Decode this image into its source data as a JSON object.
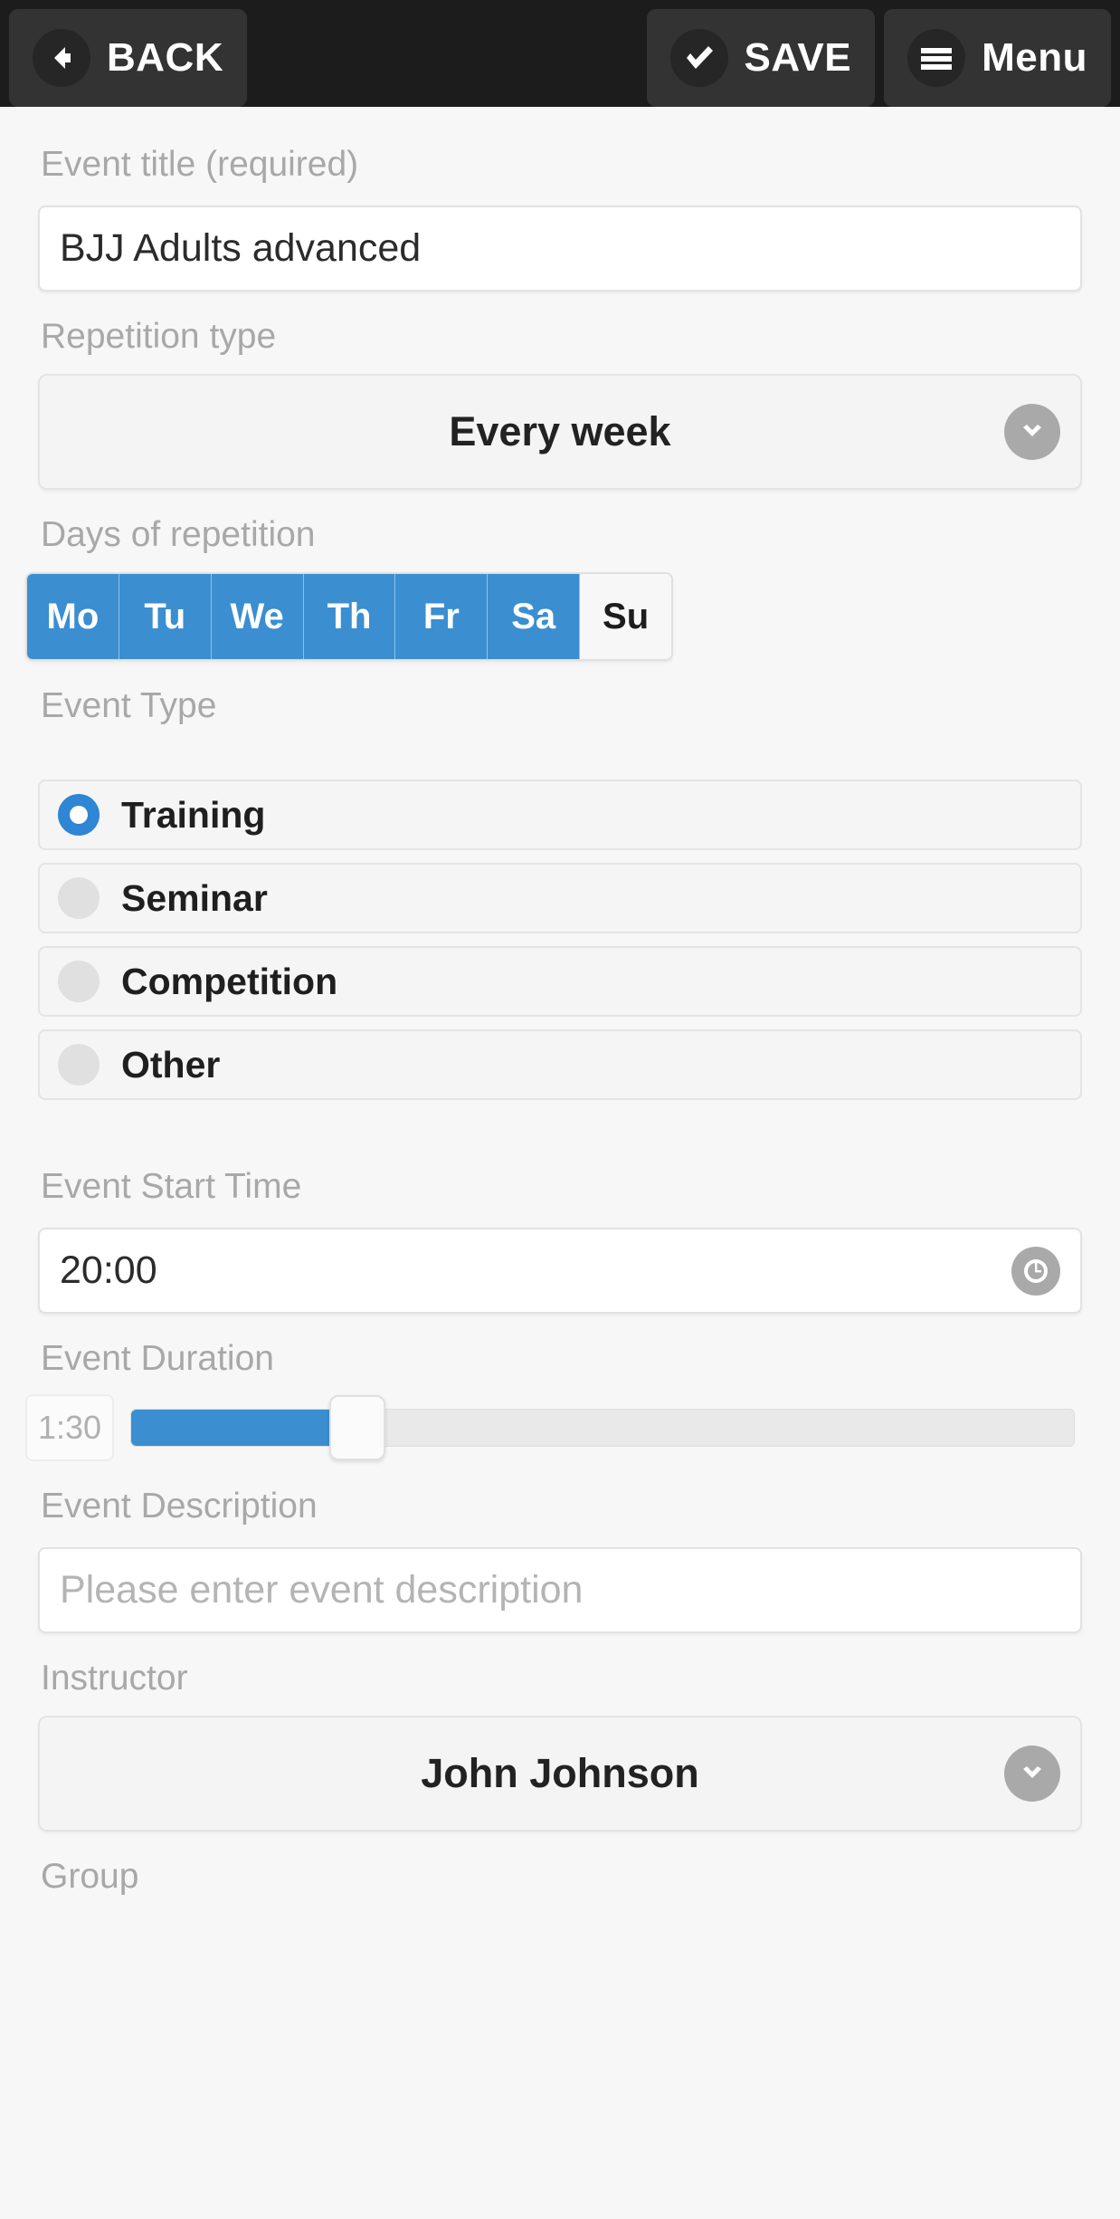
{
  "topbar": {
    "back_label": "BACK",
    "back_icon": "arrow-left-icon",
    "save_label": "SAVE",
    "save_icon": "check-icon",
    "menu_label": "Menu",
    "menu_icon": "hamburger-icon",
    "background_color": "#1c1c1c",
    "button_color": "#333333"
  },
  "form": {
    "title": {
      "label": "Event title (required)",
      "value": "BJJ Adults advanced"
    },
    "repetition_type": {
      "label": "Repetition type",
      "value": "Every week",
      "icon": "chevron-down-icon"
    },
    "days_of_repetition": {
      "label": "Days of repetition",
      "days": [
        {
          "label": "Mo",
          "selected": true
        },
        {
          "label": "Tu",
          "selected": true
        },
        {
          "label": "We",
          "selected": true
        },
        {
          "label": "Th",
          "selected": true
        },
        {
          "label": "Fr",
          "selected": true
        },
        {
          "label": "Sa",
          "selected": true
        },
        {
          "label": "Su",
          "selected": false
        }
      ]
    },
    "event_type": {
      "label": "Event Type",
      "options": [
        {
          "label": "Training",
          "selected": true
        },
        {
          "label": "Seminar",
          "selected": false
        },
        {
          "label": "Competition",
          "selected": false
        },
        {
          "label": "Other",
          "selected": false
        }
      ]
    },
    "start_time": {
      "label": "Event Start Time",
      "value": "20:00",
      "icon": "clock-icon"
    },
    "duration": {
      "label": "Event Duration",
      "value": "1:30",
      "fill_percent": 24
    },
    "description": {
      "label": "Event Description",
      "placeholder": "Please enter event description",
      "value": ""
    },
    "instructor": {
      "label": "Instructor",
      "value": "John Johnson",
      "icon": "chevron-down-icon"
    },
    "group": {
      "label": "Group"
    }
  },
  "colors": {
    "accent_blue": "#3b8ed0",
    "radio_blue": "#2e86d4",
    "label_gray": "#a8a8a8",
    "page_bg": "#f7f7f7"
  }
}
